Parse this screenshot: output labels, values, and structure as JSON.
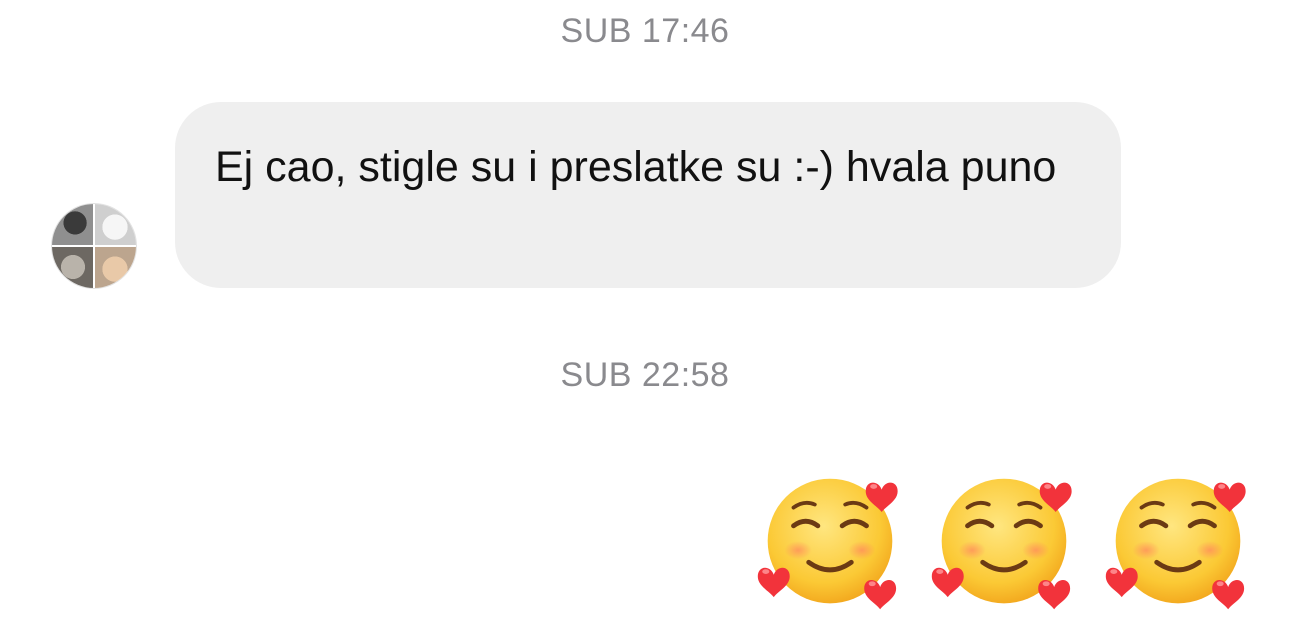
{
  "conversation": {
    "timestamps": [
      "SUB 17:46",
      "SUB 22:58"
    ],
    "incoming_message": {
      "text": "Ej cao, stigle su i preslatke su :-) hvala puno"
    },
    "outgoing_message": {
      "emojis": [
        "smiling-face-with-hearts",
        "smiling-face-with-hearts",
        "smiling-face-with-hearts"
      ]
    }
  },
  "colors": {
    "background": "#ffffff",
    "bubble_incoming": "#efefef",
    "timestamp_text": "#8a8a8e",
    "message_text": "#111111",
    "emoji_face": "#fbc935",
    "emoji_heart": "#f2333b"
  }
}
